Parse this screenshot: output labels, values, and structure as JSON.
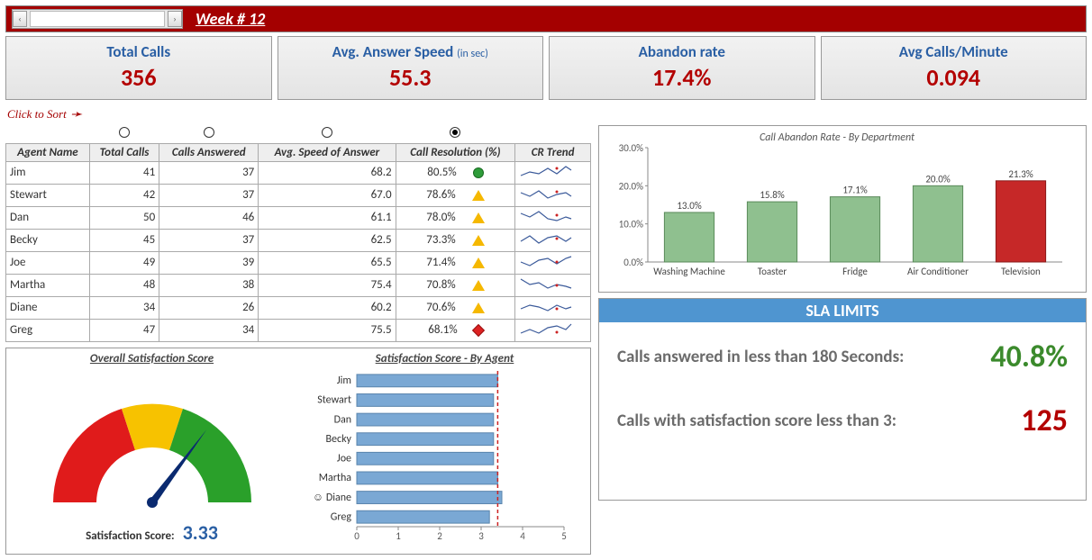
{
  "header": {
    "week_label": "Week # 12"
  },
  "kpis": {
    "total_calls": {
      "title": "Total Calls",
      "value": "356"
    },
    "answer_speed": {
      "title": "Avg. Answer Speed",
      "sub": "(in sec)",
      "value": "55.3"
    },
    "abandon": {
      "title": "Abandon rate",
      "value": "17.4%"
    },
    "calls_min": {
      "title": "Avg Calls/Minute",
      "value": "0.094"
    }
  },
  "sort_hint": "Click to Sort",
  "table": {
    "headers": {
      "agent": "Agent Name",
      "total": "Total Calls",
      "answered": "Calls Answered",
      "speed": "Avg. Speed of Answer",
      "resolution": "Call Resolution (%)",
      "trend": "CR Trend"
    },
    "selected_sort_col": 4,
    "rows": [
      {
        "name": "Jim",
        "total": "41",
        "answered": "37",
        "speed": "68.2",
        "res": "80.5%",
        "ind": "circle"
      },
      {
        "name": "Stewart",
        "total": "42",
        "answered": "37",
        "speed": "67.0",
        "res": "78.6%",
        "ind": "tri"
      },
      {
        "name": "Dan",
        "total": "50",
        "answered": "46",
        "speed": "61.1",
        "res": "78.0%",
        "ind": "tri"
      },
      {
        "name": "Becky",
        "total": "45",
        "answered": "37",
        "speed": "62.5",
        "res": "73.3%",
        "ind": "tri"
      },
      {
        "name": "Joe",
        "total": "49",
        "answered": "39",
        "speed": "65.5",
        "res": "71.4%",
        "ind": "tri"
      },
      {
        "name": "Martha",
        "total": "48",
        "answered": "38",
        "speed": "75.4",
        "res": "70.8%",
        "ind": "tri"
      },
      {
        "name": "Diane",
        "total": "34",
        "answered": "26",
        "speed": "60.2",
        "res": "70.6%",
        "ind": "tri"
      },
      {
        "name": "Greg",
        "total": "47",
        "answered": "34",
        "speed": "75.5",
        "res": "68.1%",
        "ind": "diam"
      }
    ]
  },
  "gauge": {
    "title": "Overall Satisfaction Score",
    "label": "Satisfaction Score:",
    "value": "3.33"
  },
  "satisfaction_by_agent": {
    "title": "Satisfaction Score - By Agent"
  },
  "abandon_chart_title": "Call Abandon Rate - By Department",
  "sla": {
    "header": "SLA LIMITS",
    "row1_text": "Calls answered in less than 180 Seconds:",
    "row1_val": "40.8%",
    "row2_text": "Calls with satisfaction score less than 3:",
    "row2_val": "125"
  },
  "chart_data": [
    {
      "type": "bar",
      "title": "Call Abandon Rate - By Department",
      "categories": [
        "Washing Machine",
        "Toaster",
        "Fridge",
        "Air Conditioner",
        "Television"
      ],
      "values": [
        13.0,
        15.8,
        17.1,
        20.0,
        21.3
      ],
      "highlight_index": 4,
      "ylabel": "",
      "ylim": [
        0,
        30
      ],
      "y_ticks": [
        "0.0%",
        "10.0%",
        "20.0%",
        "30.0%"
      ],
      "data_labels": [
        "13.0%",
        "15.8%",
        "17.1%",
        "20.0%",
        "21.3%"
      ]
    },
    {
      "type": "bar",
      "orientation": "horizontal",
      "title": "Satisfaction Score - By Agent",
      "categories": [
        "Jim",
        "Stewart",
        "Dan",
        "Becky",
        "Joe",
        "Martha",
        "Diane",
        "Greg"
      ],
      "values": [
        3.4,
        3.3,
        3.3,
        3.3,
        3.3,
        3.4,
        3.5,
        3.2
      ],
      "target_line": 3.4,
      "xlim": [
        0,
        5
      ],
      "x_ticks": [
        "0",
        "1",
        "2",
        "3",
        "4",
        "5"
      ],
      "highlight_agent": "Diane"
    },
    {
      "type": "gauge",
      "title": "Overall Satisfaction Score",
      "value": 3.33,
      "min": 0,
      "max": 5,
      "zones": [
        {
          "from": 0,
          "to": 2.5,
          "color": "#e01b1b"
        },
        {
          "from": 2.5,
          "to": 3.5,
          "color": "#f7c200"
        },
        {
          "from": 3.5,
          "to": 5,
          "color": "#2aa02a"
        }
      ]
    }
  ]
}
